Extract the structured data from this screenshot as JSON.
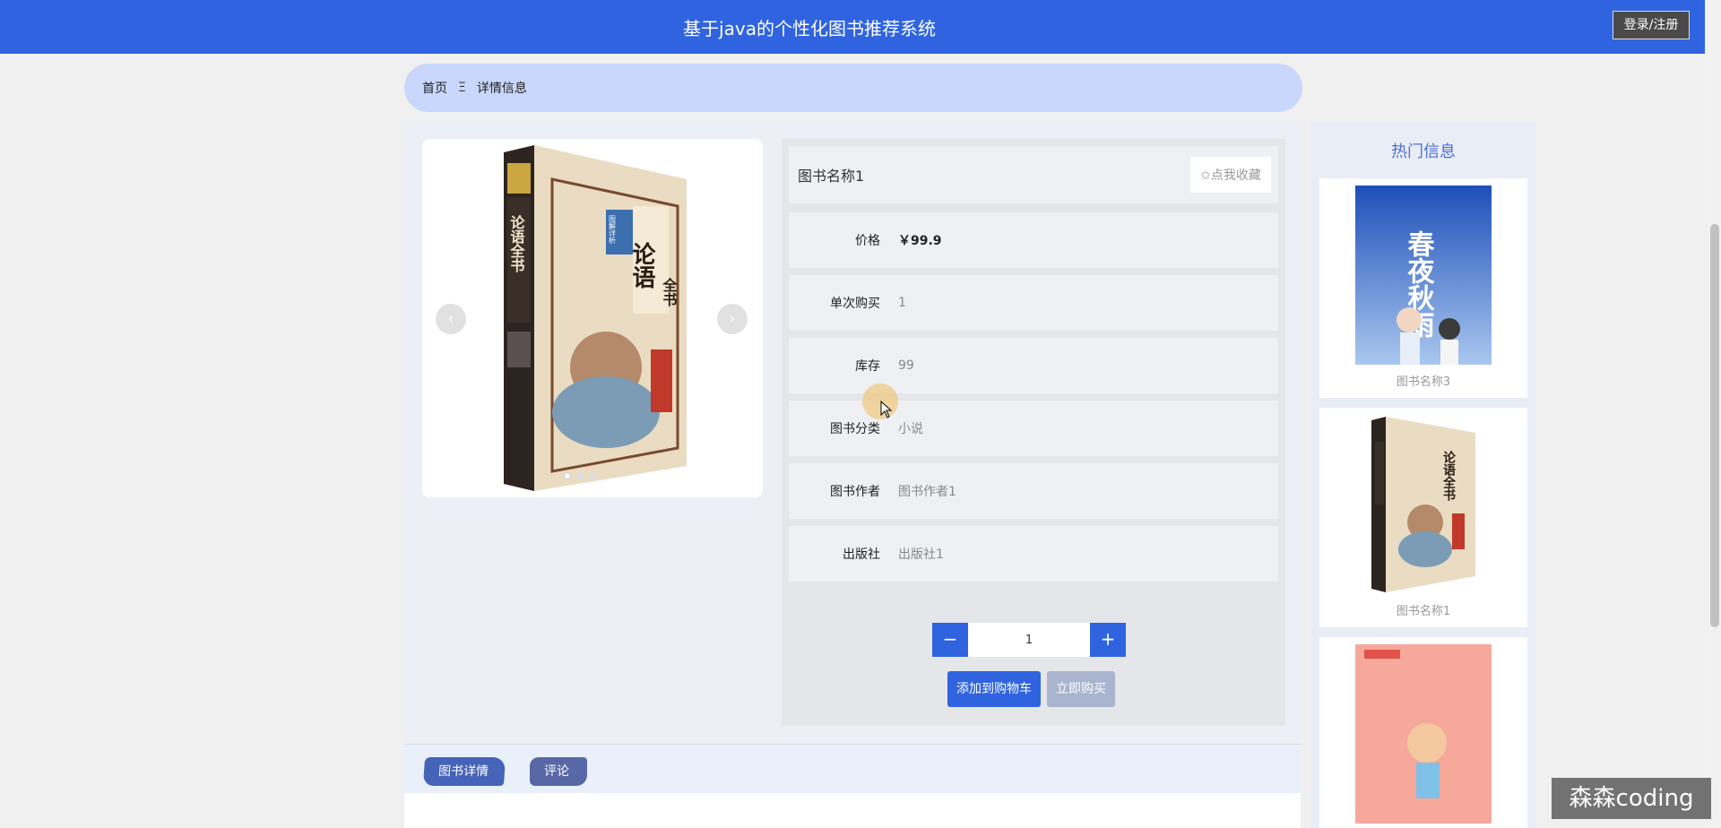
{
  "header": {
    "title": "基于java的个性化图书推荐系统",
    "login_label": "登录/注册"
  },
  "breadcrumb": {
    "home": "首页",
    "separator": "Ξ",
    "current": "详情信息"
  },
  "product": {
    "name": "图书名称1",
    "favorite_label": "✩点我收藏",
    "fields": [
      {
        "label": "价格",
        "value": "￥99.9"
      },
      {
        "label": "单次购买",
        "value": "1"
      },
      {
        "label": "库存",
        "value": "99"
      },
      {
        "label": "图书分类",
        "value": "小说"
      },
      {
        "label": "图书作者",
        "value": "图书作者1"
      },
      {
        "label": "出版社",
        "value": "出版社1"
      }
    ],
    "cover": {
      "title": "论语",
      "subtitle": "全书",
      "spine_title": "论语全书",
      "badge": "图解详析"
    },
    "quantity": "1",
    "minus_label": "−",
    "plus_label": "+",
    "add_to_cart_label": "添加到购物车",
    "buy_now_label": "立即购买",
    "prev_arrow": "‹",
    "next_arrow": "›"
  },
  "tabs": [
    {
      "label": "图书详情"
    },
    {
      "label": "评论"
    }
  ],
  "hot": {
    "title": "热门信息",
    "items": [
      {
        "name": "图书名称3",
        "cover_title": "春夜秋雨"
      },
      {
        "name": "图书名称1",
        "cover_title": "论语全书"
      },
      {
        "name": ""
      }
    ]
  },
  "watermark": "森森coding",
  "colors": {
    "primary": "#2f63e0",
    "breadcrumb_bg": "#c8d7fb",
    "hot_title": "#4a6fd6"
  }
}
